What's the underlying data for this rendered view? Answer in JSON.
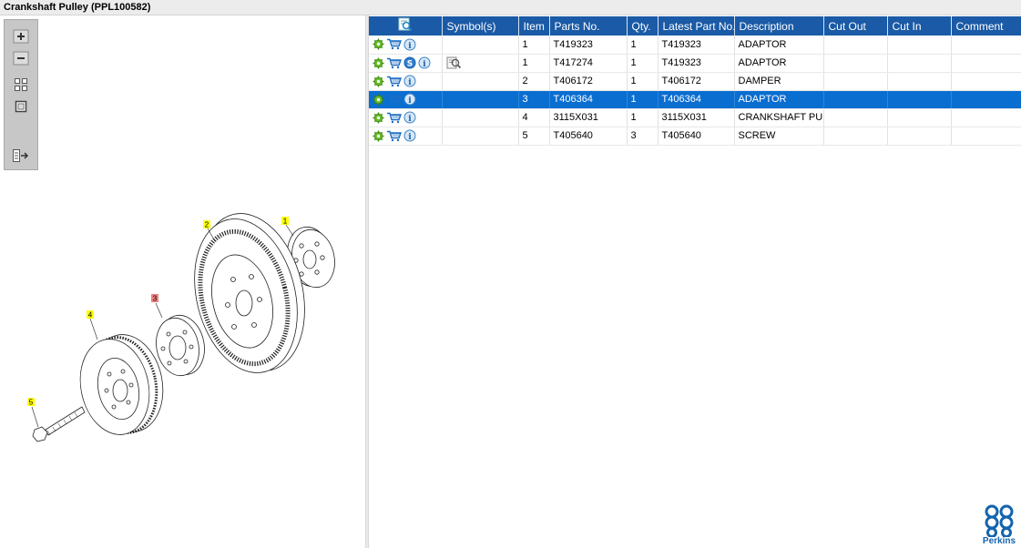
{
  "window": {
    "title": "Crankshaft Pulley (PPL100582)"
  },
  "toolbox": {
    "icons": [
      "zoom-in-icon",
      "zoom-out-icon",
      "fit-grid-icon",
      "actual-size-icon",
      "export-icon"
    ]
  },
  "drawing": {
    "callouts": [
      "1",
      "2",
      "3",
      "4",
      "5"
    ],
    "selected_callout": "3"
  },
  "table": {
    "headers": {
      "actions_icon": "search-document-icon",
      "symbols": "Symbol(s)",
      "item": "Item",
      "parts_no": "Parts No.",
      "qty": "Qty.",
      "latest_part_no": "Latest Part No.",
      "description": "Description",
      "cut_out": "Cut Out",
      "cut_in": "Cut In",
      "comment": "Comment"
    },
    "rows": [
      {
        "item": "1",
        "parts_no": "T419323",
        "qty": "1",
        "latest": "T419323",
        "description": "ADAPTOR",
        "cut_out": "",
        "cut_in": "",
        "comment": ""
      },
      {
        "item": "1",
        "parts_no": "T417274",
        "qty": "1",
        "latest": "T419323",
        "description": "ADAPTOR",
        "cut_out": "",
        "cut_in": "",
        "comment": "",
        "superseded_badge": "S"
      },
      {
        "item": "2",
        "parts_no": "T406172",
        "qty": "1",
        "latest": "T406172",
        "description": "DAMPER",
        "cut_out": "",
        "cut_in": "",
        "comment": ""
      },
      {
        "item": "3",
        "parts_no": "T406364",
        "qty": "1",
        "latest": "T406364",
        "description": "ADAPTOR",
        "cut_out": "",
        "cut_in": "",
        "comment": ""
      },
      {
        "item": "4",
        "parts_no": "3115X031",
        "qty": "1",
        "latest": "3115X031",
        "description": "CRANKSHAFT PULL",
        "cut_out": "",
        "cut_in": "",
        "comment": ""
      },
      {
        "item": "5",
        "parts_no": "T405640",
        "qty": "3",
        "latest": "T405640",
        "description": "SCREW",
        "cut_out": "",
        "cut_in": "",
        "comment": ""
      }
    ],
    "selected_row_index": 3
  },
  "brand": {
    "name": "Perkins",
    "color": "#1464ae"
  },
  "colors": {
    "header": "#1a5aa6",
    "selection": "#0a6ed1",
    "callout_yellow": "#ffff00",
    "callout_red": "#f08080"
  }
}
